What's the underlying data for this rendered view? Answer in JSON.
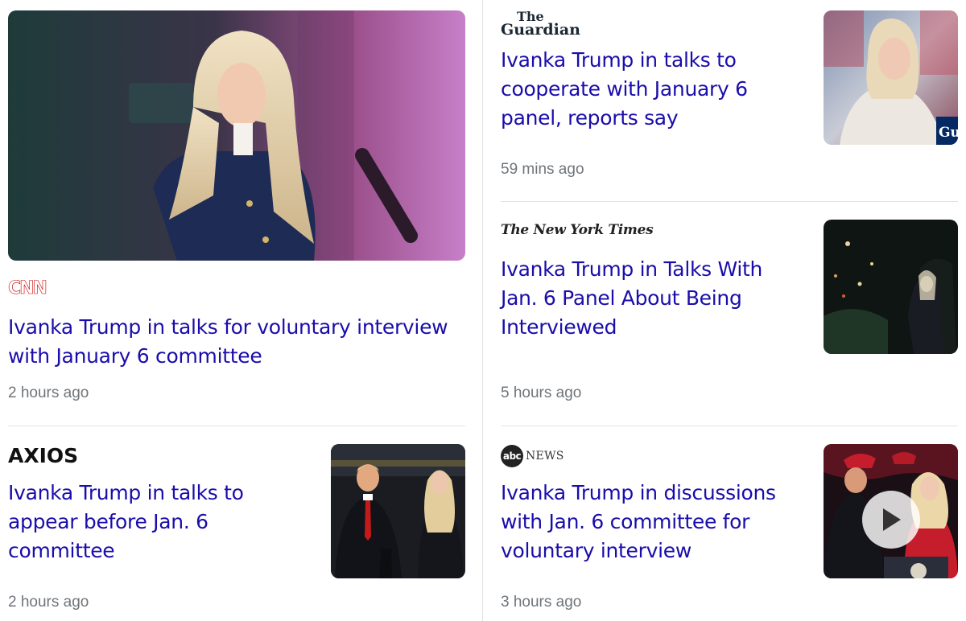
{
  "articles": [
    {
      "source": "CNN",
      "title": "Ivanka Trump in talks for voluntary interview with January 6 committee",
      "time": "2 hours ago"
    },
    {
      "source_line1": "The",
      "source_line2": "Guardian",
      "title": "Ivanka Trump in talks to cooperate with January 6 panel, reports say",
      "time": "59 mins ago"
    },
    {
      "source": "The New York Times",
      "title": "Ivanka Trump in Talks With Jan. 6 Panel About Being Interviewed",
      "time": "5 hours ago"
    },
    {
      "source": "AXIOS",
      "title": "Ivanka Trump in talks to appear before Jan. 6 committee",
      "time": "2 hours ago"
    },
    {
      "source_mark": "abc",
      "source_word": "NEWS",
      "title": "Ivanka Trump in discussions with Jan. 6 committee for voluntary interview",
      "time": "3 hours ago",
      "has_video": true
    }
  ],
  "thumb_overlay_text": "Gu",
  "colors": {
    "title_link": "#1a0dab",
    "timestamp": "#70757a",
    "divider": "#e3e3e3",
    "cnn_red": "#cc0000"
  },
  "icons": [
    "play-icon"
  ]
}
